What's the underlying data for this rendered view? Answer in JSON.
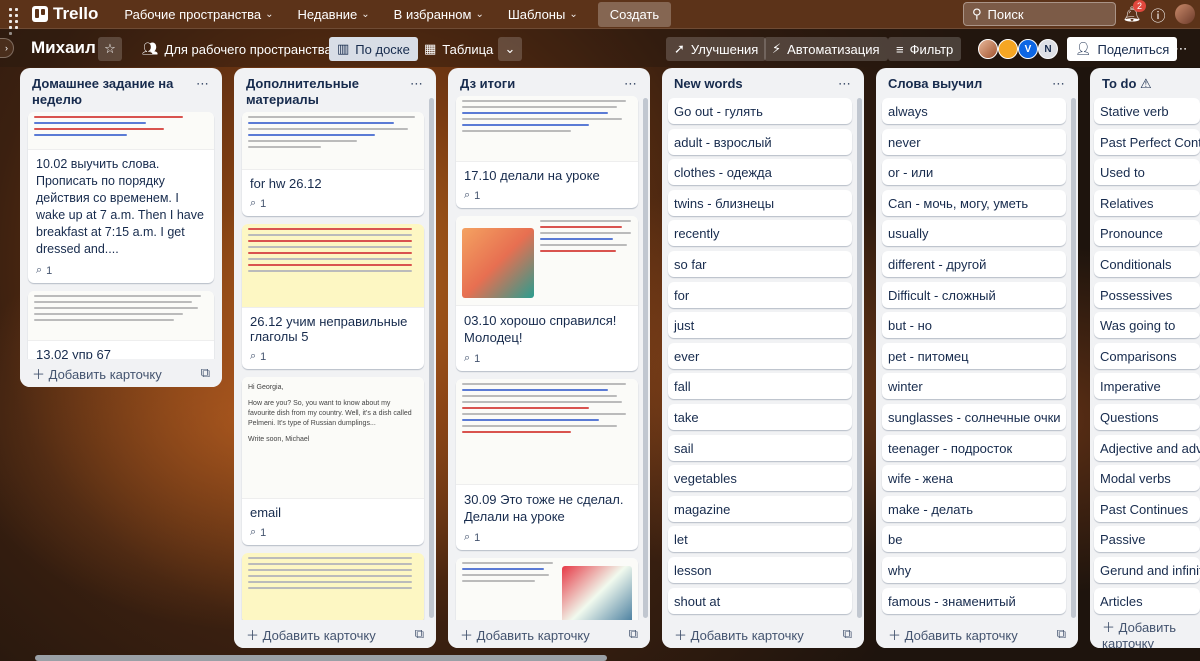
{
  "topbar": {
    "app": "Trello",
    "menus": [
      "Рабочие пространства",
      "Недавние",
      "В избранном",
      "Шаблоны"
    ],
    "create": "Создать",
    "search_placeholder": "Поиск",
    "notif_count": "2"
  },
  "boardbar": {
    "name": "Михаил",
    "visibility": "Для рабочего пространства",
    "view_board": "По доске",
    "view_table": "Таблица",
    "upgrades": "Улучшения",
    "automation": "Автоматизация",
    "filter": "Фильтр",
    "share": "Поделиться",
    "avatars": [
      "V",
      "N"
    ]
  },
  "add_card": "Добавить карточку",
  "lists": [
    {
      "title": "Домашнее задание на неделю",
      "cards": [
        {
          "text": "10.02 выучить слова. Прописать по порядку действия со временем. I wake up at 7 a.m. Then I have breakfast at 7:15 a.m. I get dressed and....",
          "count": "1"
        },
        {
          "text": "13.02 упр 67",
          "count": "1"
        }
      ]
    },
    {
      "title": "Дополнительные материалы",
      "cards": [
        {
          "text": "for hw 26.12",
          "count": "1"
        },
        {
          "text": "26.12 учим неправильные глаголы 5",
          "count": "1"
        },
        {
          "text": "email",
          "count": "1"
        }
      ]
    },
    {
      "title": "Дз итоги",
      "cards": [
        {
          "text": "17.10 делали на уроке",
          "count": "1"
        },
        {
          "text": "03.10 хорошо справился! Молодец!",
          "count": "1"
        },
        {
          "text": "30.09 Это тоже не сделал. Делали на уроке",
          "count": "1"
        }
      ]
    },
    {
      "title": "New words",
      "cards": [
        "Go out - гулять",
        "adult - взрослый",
        "clothes - одежда",
        "twins - близнецы",
        "recently",
        "so far",
        "for",
        "just",
        "ever",
        "fall",
        "take",
        "sail",
        "vegetables",
        "magazine",
        "let",
        "lesson",
        "shout at"
      ]
    },
    {
      "title": "Слова выучил",
      "cards": [
        "always",
        "never",
        "or - или",
        "Can - мочь, могу, уметь",
        "usually",
        "different - другой",
        "Difficult - сложный",
        "but - но",
        "pet - питомец",
        "winter",
        "sunglasses - солнечные очки",
        "teenager - подросток",
        "wife - жена",
        "make - делать",
        "be",
        "why",
        "famous - знаменитый"
      ]
    },
    {
      "title": "To do ⚠",
      "cards": [
        "Stative verb",
        "Past Perfect Continuous",
        "Used to",
        "Relatives",
        "Pronounce",
        "Conditionals",
        "Possessives",
        "Was going to",
        "Comparisons",
        "Imperative",
        "Questions",
        "Adjective and adverb",
        "Modal verbs",
        "Past Continues",
        "Passive",
        "Gerund and infinitive",
        "Articles"
      ]
    }
  ],
  "email_preview": {
    "greeting": "Hi Georgia,",
    "body": "How are you? So, you want to know about my favourite dish from my country. Well, it's a dish called Pelmeni. It's type of Russian dumplings...",
    "sign": "Write soon, Michael"
  }
}
